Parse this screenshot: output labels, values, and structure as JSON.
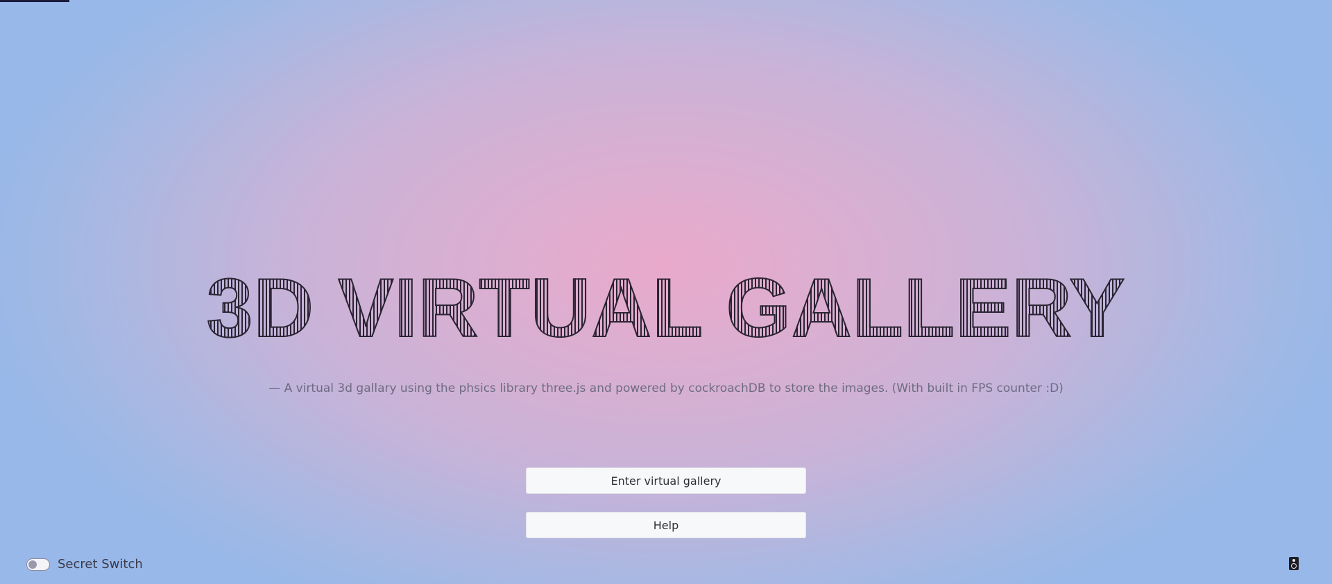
{
  "hero": {
    "title": "3D VIRTUAL GALLERY",
    "subtitle": "— A virtual 3d gallary using the phsics library three.js and powered by cockroachDB to store the images. (With built in FPS counter :D)"
  },
  "buttons": {
    "enter_label": "Enter virtual gallery",
    "help_label": "Help"
  },
  "footer": {
    "switch_label": "Secret Switch",
    "switch_on": false,
    "sound_icon": "speaker-icon"
  },
  "colors": {
    "background_center": "#e9a9cb",
    "background_edge": "#97b8e8",
    "title": "#2b2433",
    "button_bg": "#f7f8fa"
  }
}
